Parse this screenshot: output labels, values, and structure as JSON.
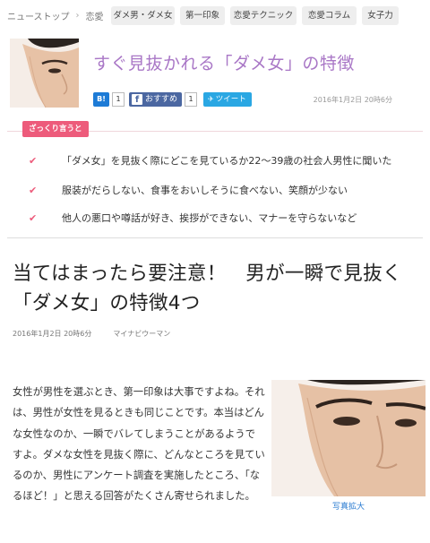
{
  "nav": {
    "breadcrumb_home": "ニューストップ",
    "breadcrumb_sep": "›",
    "breadcrumb_current": "恋愛",
    "tags": [
      "ダメ男・ダメ女",
      "第一印象",
      "恋愛テクニック",
      "恋愛コラム",
      "女子力"
    ]
  },
  "hero": {
    "title": "すぐ見抜かれる「ダメ女」の特徴",
    "date": "2016年1月2日 20時6分"
  },
  "social": {
    "hatena_label": "B!",
    "hatena_count": "1",
    "facebook_label": "おすすめ",
    "facebook_count": "1",
    "twitter_label": "ツイート"
  },
  "summary": {
    "label": "ざっくり言うと",
    "items": [
      "「ダメ女」を見抜く際にどこを見ているか22〜39歳の社会人男性に聞いた",
      "服装がだらしない、食事をおいしそうに食べない、笑顔が少ない",
      "他人の悪口や噂話が好き、挨拶ができない、マナーを守らないなど"
    ]
  },
  "article": {
    "title": "当てはまったら要注意！　男が一瞬で見抜く「ダメ女」の特徴4つ",
    "date": "2016年1月2日 20時6分",
    "source": "マイナビウーマン",
    "body": "女性が男性を選ぶとき、第一印象は大事ですよね。それは、男性が女性を見るときも同じことです。本当はどんな女性なのか、一瞬でバレてしまうことがあるようですよ。ダメな女性を見抜く際に、どんなところを見ているのか、男性にアンケート調査を実施したところ、「なるほど！」と思える回答がたくさん寄せられました。",
    "photo_caption": "写真拡大"
  },
  "colors": {
    "accent_pink": "#ed5b7b",
    "title_purple": "#a977c6",
    "facebook": "#4b67a1",
    "twitter": "#2aa7e3",
    "link": "#2a7bd1"
  }
}
